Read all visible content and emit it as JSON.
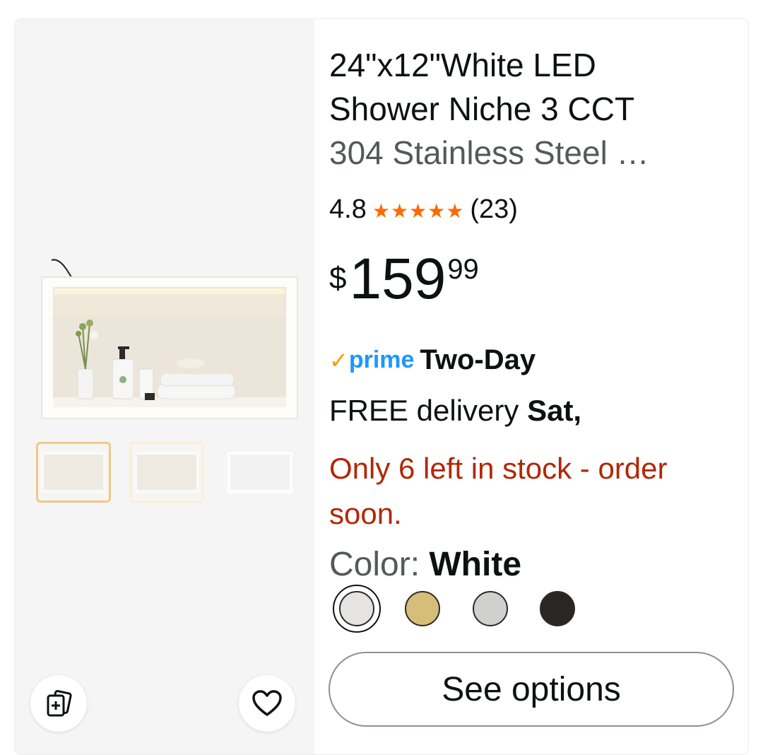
{
  "product": {
    "title": "24\"x12\"White LED\nShower Niche 3 CCT",
    "subtitle": "304 Stainless Steel …",
    "rating": "4.8",
    "rating_stars": 5,
    "review_count": "(23)",
    "price": {
      "symbol": "$",
      "whole": "159",
      "fraction": "99"
    },
    "prime": {
      "logo": "prime",
      "speed": "Two-Day"
    },
    "delivery": {
      "prefix": "FREE delivery ",
      "day": "Sat,"
    },
    "stock": "Only 6 left in stock - order soon.",
    "color": {
      "label": "Color: ",
      "value": "White"
    },
    "swatches": [
      {
        "name": "White",
        "color": "#e6e4e0",
        "selected": true
      },
      {
        "name": "Gold",
        "color": "#d6bd78",
        "selected": false
      },
      {
        "name": "Silver",
        "color": "#d0d0cf",
        "selected": false
      },
      {
        "name": "Black",
        "color": "#2a2623",
        "selected": false
      }
    ],
    "cta": "See options"
  },
  "images": {
    "thumbnails": [
      "thumbnail-white-lit",
      "thumbnail-white-warm",
      "thumbnail-white-plain"
    ],
    "selected_thumbnail": 0
  },
  "icons": {
    "compare": "compare-add-icon",
    "wishlist": "heart-icon",
    "prime_check": "prime-check-icon",
    "star": "star-icon"
  },
  "colors": {
    "stock_red": "#b12704",
    "star_orange": "#ff6a00",
    "prime_blue": "#1a98ff",
    "prime_check": "#ff9900"
  }
}
